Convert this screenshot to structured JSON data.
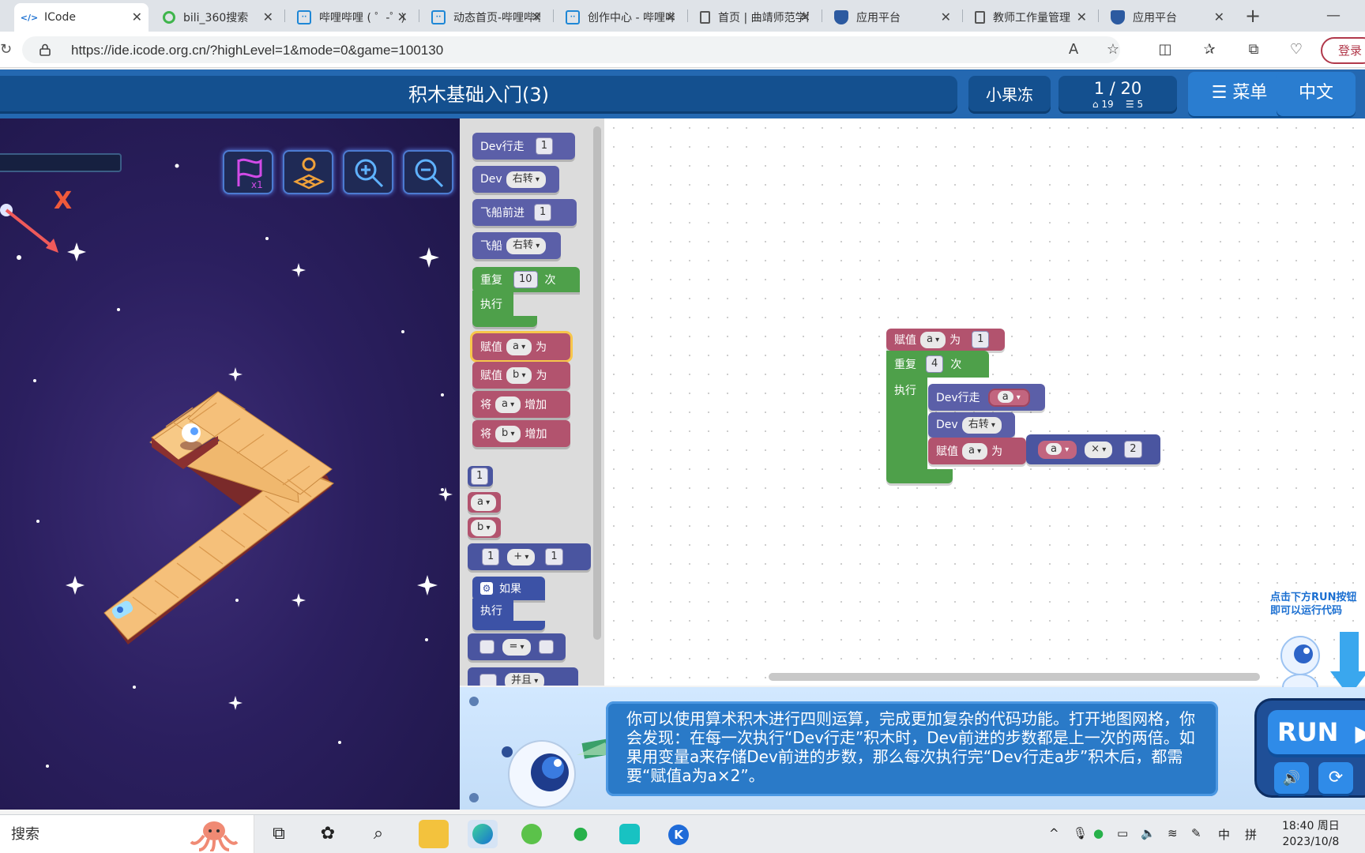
{
  "browser": {
    "tabs": [
      {
        "label": "ICode",
        "active": true,
        "icon": "code-icon"
      },
      {
        "label": "bili_360搜索",
        "active": false,
        "icon": "search-360-icon"
      },
      {
        "label": "哔哩哔哩 ( ゜-゜)",
        "active": false,
        "icon": "bilibili-tv-icon"
      },
      {
        "label": "动态首页-哔哩哔哩",
        "active": false,
        "icon": "bilibili-tv-icon"
      },
      {
        "label": "创作中心 - 哔哩哔哩",
        "active": false,
        "icon": "bilibili-tv-icon"
      },
      {
        "label": "首页 | 曲靖师范学院",
        "active": false,
        "icon": "document-icon"
      },
      {
        "label": "应用平台",
        "active": false,
        "icon": "shield-icon"
      },
      {
        "label": "教师工作量管理",
        "active": false,
        "icon": "document-icon"
      },
      {
        "label": "应用平台",
        "active": false,
        "icon": "shield-icon"
      }
    ],
    "new_tab": "+",
    "minimize": "—",
    "url": "https://ide.icode.org.cn/?highLevel=1&mode=0&game=100130",
    "login_label": "登录"
  },
  "header": {
    "title": "积木基础入门(3)",
    "user_name": "小果冻",
    "progress": "1 / 20",
    "stat_left": "⌂ 19",
    "stat_right": "☰ 5",
    "menu_label": "菜单",
    "language_label": "中文"
  },
  "stage": {
    "axis_label": "X"
  },
  "palette": {
    "dev_walk": {
      "label": "Dev行走",
      "value": "1"
    },
    "dev_turn": {
      "label": "Dev",
      "option": "右转"
    },
    "ship_forward": {
      "label": "飞船前进",
      "value": "1"
    },
    "ship_turn": {
      "label": "飞船",
      "option": "右转"
    },
    "repeat": {
      "label": "重复",
      "value": "10",
      "suffix": "次",
      "do": "执行"
    },
    "assign_a": {
      "label": "赋值",
      "var": "a",
      "suffix": "为"
    },
    "assign_b": {
      "label": "赋值",
      "var": "b",
      "suffix": "为"
    },
    "inc_a": {
      "label": "将",
      "var": "a",
      "suffix": "增加"
    },
    "inc_b": {
      "label": "将",
      "var": "b",
      "suffix": "增加"
    },
    "num": "1",
    "var_a": "a",
    "var_b": "b",
    "arith": {
      "left": "1",
      "op": "+",
      "right": "1"
    },
    "if_block": {
      "label": "如果",
      "do": "执行"
    },
    "compare": {
      "op": "="
    },
    "and_block": {
      "op": "并且"
    }
  },
  "workspace": {
    "assign": {
      "label": "赋值",
      "var": "a",
      "suffix": "为",
      "value": "1"
    },
    "repeat": {
      "label": "重复",
      "value": "4",
      "suffix": "次",
      "do": "执行"
    },
    "dev_walk": {
      "label": "Dev行走",
      "var": "a"
    },
    "dev_turn": {
      "label": "Dev",
      "option": "右转"
    },
    "assign2": {
      "label": "赋值",
      "var": "a",
      "suffix": "为",
      "left": "a",
      "op": "×",
      "right": "2"
    },
    "hint_line1": "点击下方RUN按钮",
    "hint_line2": "即可以运行代码"
  },
  "tip": {
    "text": "你可以使用算术积木进行四则运算，完成更加复杂的代码功能。打开地图网格，你会发现：在每一次执行“Dev行走”积木时，Dev前进的步数都是上一次的两倍。如果用变量a来存储Dev前进的步数，那么每次执行完“Dev行走a步”积木后，都需要“赋值a为a×2”。"
  },
  "run": {
    "label": "RUN",
    "sound": "🔊",
    "reset": "⟳"
  },
  "taskbar": {
    "search_label": "搜索",
    "ime": "中",
    "layout": "拼",
    "time": "18:40 周日",
    "date": "2023/10/8"
  },
  "colors": {
    "header_blue": "#2468b1",
    "stage_purple": "#2b1f5f",
    "block_dev": "#5b5fa8",
    "block_var": "#b2536e",
    "block_loop": "#4ea04a"
  }
}
